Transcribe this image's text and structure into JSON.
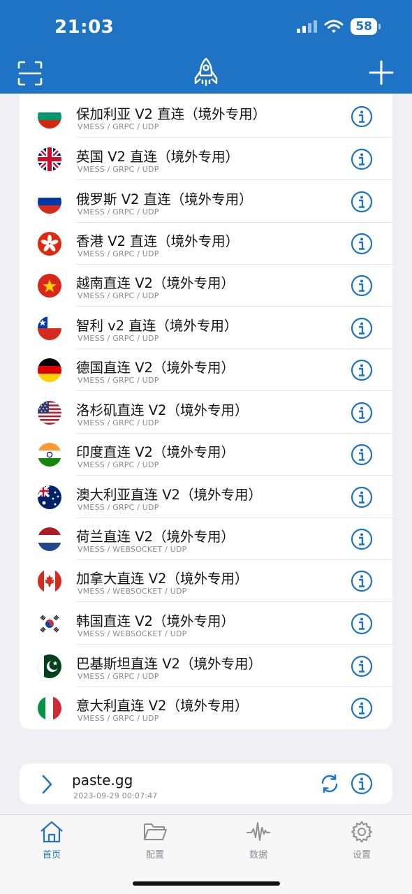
{
  "status": {
    "time": "21:03",
    "battery": "58"
  },
  "colors": {
    "accent": "#1e73c4",
    "header_bg": "#1e73c4"
  },
  "header": {
    "left_icon": "scan-icon",
    "center_icon": "rocket-icon",
    "right_icon": "plus-icon"
  },
  "servers": [
    {
      "name": "保加利亚 V2 直连（境外专用）",
      "proto": "VMESS / GRPC / UDP",
      "flag": "bulgaria"
    },
    {
      "name": "英国 V2 直连（境外专用）",
      "proto": "VMESS / GRPC / UDP",
      "flag": "uk"
    },
    {
      "name": "俄罗斯 V2 直连（境外专用）",
      "proto": "VMESS / GRPC / UDP",
      "flag": "russia"
    },
    {
      "name": "香港 V2 直连（境外专用）",
      "proto": "VMESS / GRPC / UDP",
      "flag": "hongkong"
    },
    {
      "name": "越南直连 V2（境外专用）",
      "proto": "VMESS / GRPC / UDP",
      "flag": "vietnam"
    },
    {
      "name": "智利 v2 直连（境外专用）",
      "proto": "VMESS / GRPC / UDP",
      "flag": "chile"
    },
    {
      "name": "德国直连 V2（境外专用）",
      "proto": "VMESS / GRPC / UDP",
      "flag": "germany"
    },
    {
      "name": "洛杉矶直连 V2（境外专用）",
      "proto": "VMESS / GRPC / UDP",
      "flag": "usa"
    },
    {
      "name": "印度直连 V2（境外专用）",
      "proto": "VMESS / GRPC / UDP",
      "flag": "india"
    },
    {
      "name": "澳大利亚直连 V2（境外专用）",
      "proto": "VMESS / GRPC / UDP",
      "flag": "australia"
    },
    {
      "name": "荷兰直连 V2（境外专用）",
      "proto": "VMESS / WEBSOCKET / UDP",
      "flag": "netherlands"
    },
    {
      "name": "加拿大直连 V2（境外专用）",
      "proto": "VMESS / WEBSOCKET / UDP",
      "flag": "canada"
    },
    {
      "name": "韩国直连 V2（境外专用）",
      "proto": "VMESS / WEBSOCKET / UDP",
      "flag": "korea"
    },
    {
      "name": "巴基斯坦直连 V2（境外专用）",
      "proto": "VMESS / GRPC / UDP",
      "flag": "pakistan"
    },
    {
      "name": "意大利直连 V2（境外专用）",
      "proto": "VMESS / GRPC / UDP",
      "flag": "italy"
    }
  ],
  "subscription": {
    "name": "paste.gg",
    "date": "2023-09-29 00:07:47"
  },
  "tabs": [
    {
      "label": "首页",
      "icon": "home-icon",
      "active": true
    },
    {
      "label": "配置",
      "icon": "folder-icon",
      "active": false
    },
    {
      "label": "数据",
      "icon": "pulse-icon",
      "active": false
    },
    {
      "label": "设置",
      "icon": "gear-icon",
      "active": false
    }
  ]
}
